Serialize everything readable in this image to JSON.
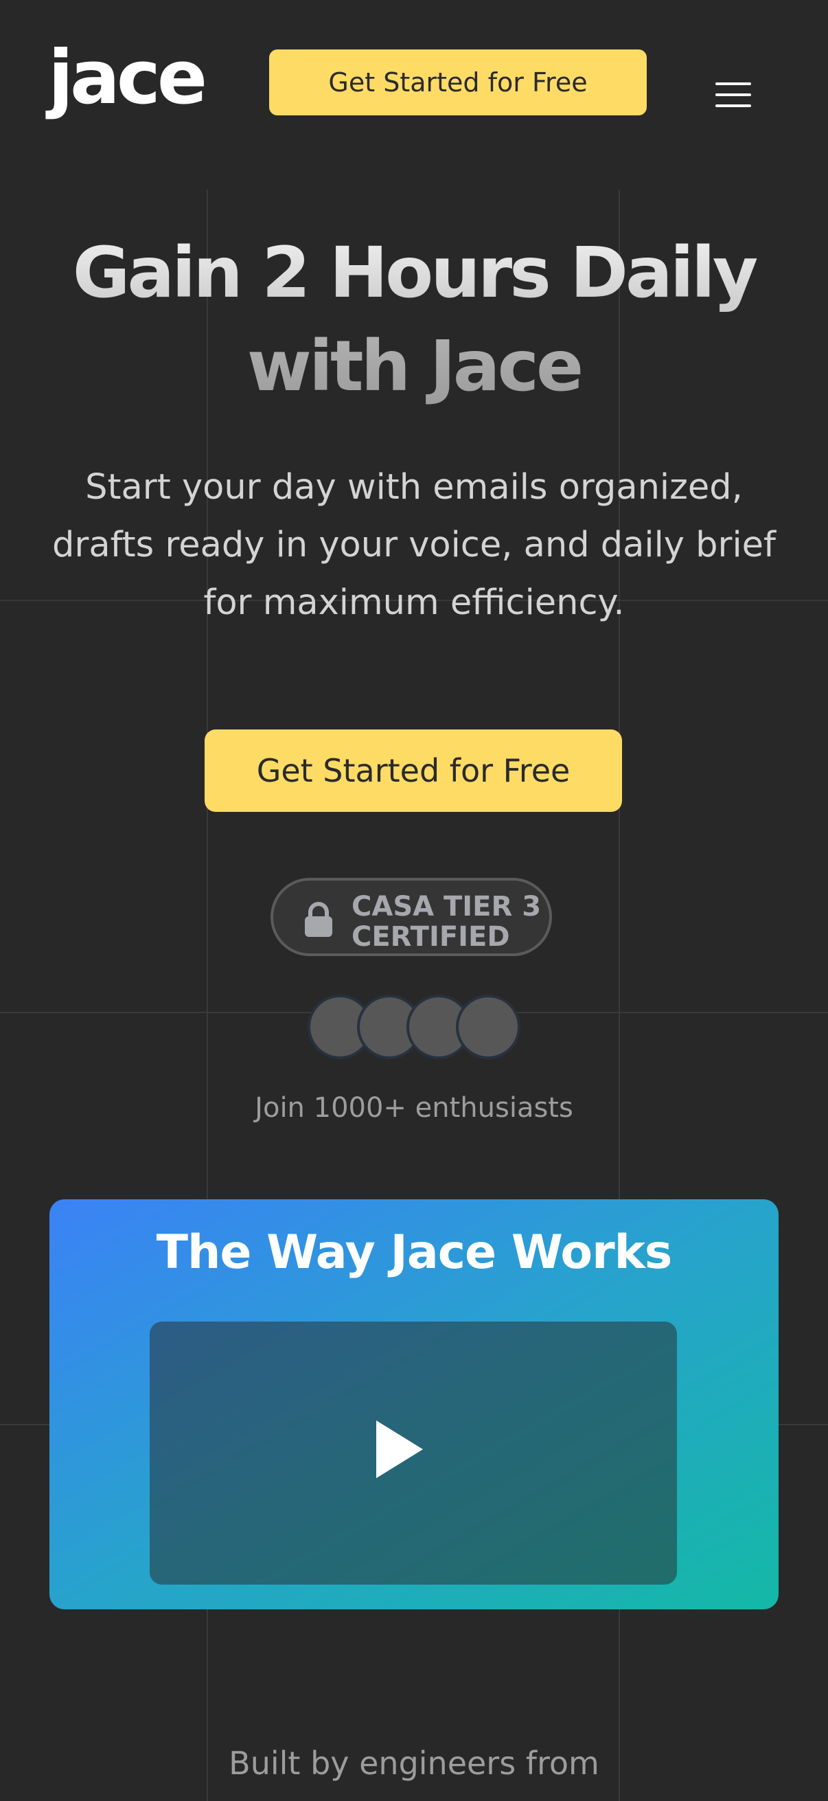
{
  "header": {
    "logo_text": "jace",
    "cta_label": "Get Started for Free",
    "menu_icon": "hamburger-menu-icon"
  },
  "hero": {
    "title_line1": "Gain 2 Hours Daily",
    "title_line2": "with Jace",
    "subtitle": "Start your day with emails organized, drafts ready in your voice, and daily brief for maximum efficiency.",
    "cta_label": "Get Started for Free"
  },
  "badge": {
    "icon": "lock-icon",
    "line1": "CASA TIER 3",
    "line2": "CERTIFIED"
  },
  "social_proof": {
    "text": "Join 1000+ enthusiasts"
  },
  "video": {
    "title": "The Way Jace Works",
    "icon": "play-icon"
  },
  "footer_teaser": {
    "text": "Built by engineers from"
  },
  "colors": {
    "background": "#282828",
    "accent_yellow": "#fedb65",
    "gradient_start": "#3b82f6",
    "gradient_end": "#14b8a6"
  }
}
